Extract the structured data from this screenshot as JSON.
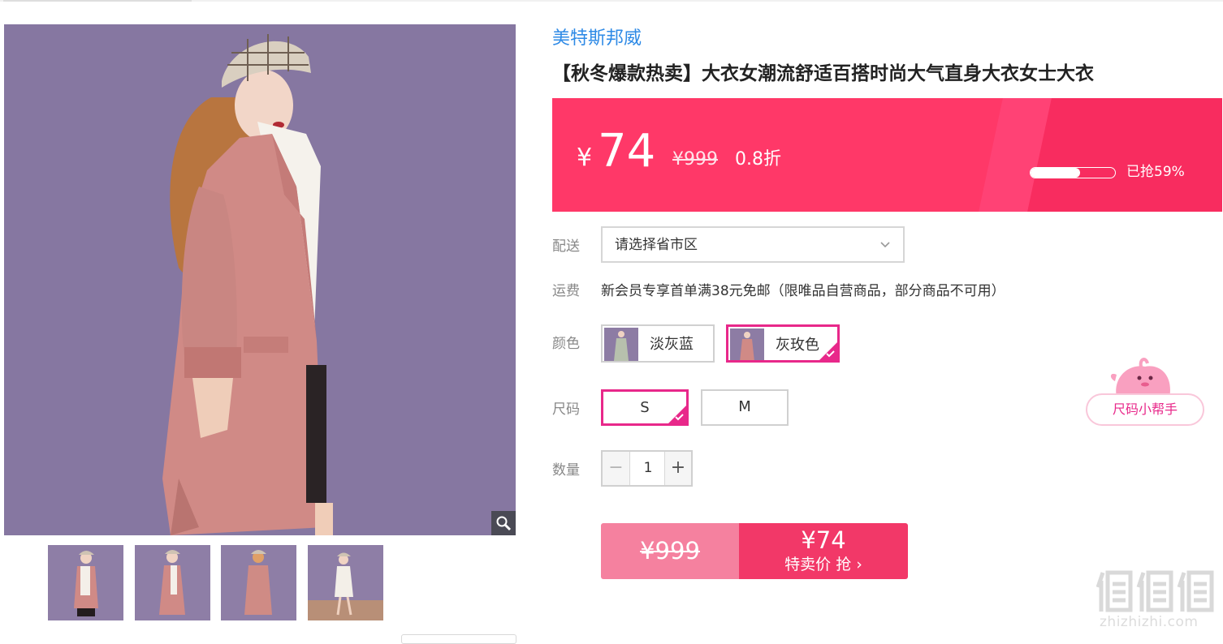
{
  "brand": {
    "name": "美特斯邦威"
  },
  "product": {
    "title": "【秋冬爆款热卖】大衣女潮流舒适百搭时尚大气直身大衣女士大衣"
  },
  "price": {
    "currency": "¥",
    "current": "74",
    "original": "¥999",
    "discount": "0.8折",
    "sold_fraction": 0.59,
    "sold_text": "已抢59%"
  },
  "delivery": {
    "label": "配送",
    "placeholder": "请选择省市区"
  },
  "shipping": {
    "label": "运费",
    "text": "新会员专享首单满38元免邮（限唯品自营商品，部分商品不可用）"
  },
  "colors": {
    "label": "颜色",
    "options": [
      {
        "name": "淡灰蓝",
        "selected": false
      },
      {
        "name": "灰玫色",
        "selected": true
      }
    ]
  },
  "sizes": {
    "label": "尺码",
    "options": [
      {
        "name": "S",
        "selected": true
      },
      {
        "name": "M",
        "selected": false
      }
    ],
    "helper": "尺码小帮手"
  },
  "quantity": {
    "label": "数量",
    "minus": "−",
    "value": "1",
    "plus": "+"
  },
  "buy": {
    "normal_price": "¥999",
    "flash_price": "¥74",
    "flash_label": "特卖价 抢 ›"
  },
  "watermark": {
    "text": "zhizhizhi.com"
  },
  "colors_theme": {
    "accent": "#e8288a",
    "banner": "#ff3868",
    "brand_link": "#2e8ae6",
    "image_background": "#8677a1",
    "coat": "#d08a86"
  },
  "icons": [
    "zoom-icon",
    "chevron-down-icon",
    "checkmark-icon",
    "mascot-icon"
  ]
}
